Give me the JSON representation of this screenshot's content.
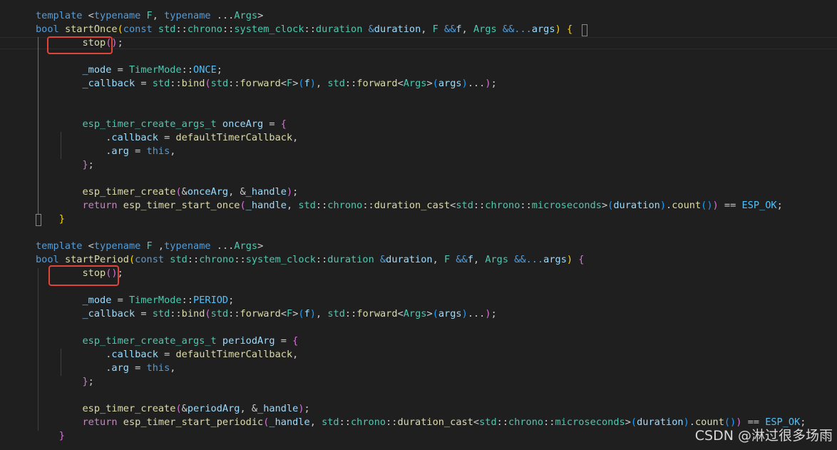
{
  "editor": {
    "lines": [
      [
        [
          "template",
          "kw"
        ],
        [
          " <",
          "pn"
        ],
        [
          "typename",
          "kw"
        ],
        [
          " ",
          "pn"
        ],
        [
          "F",
          "ty"
        ],
        [
          ", ",
          "pn"
        ],
        [
          "typename",
          "kw"
        ],
        [
          " ...",
          "pn"
        ],
        [
          "Args",
          "ty"
        ],
        [
          ">",
          "pn"
        ]
      ],
      [
        [
          "bool",
          "kw"
        ],
        [
          " ",
          "pn"
        ],
        [
          "startOnce",
          "fn"
        ],
        [
          "(",
          "b1"
        ],
        [
          "const",
          "kw"
        ],
        [
          " ",
          "pn"
        ],
        [
          "std",
          "ty"
        ],
        [
          "::",
          "pn"
        ],
        [
          "chrono",
          "ty"
        ],
        [
          "::",
          "pn"
        ],
        [
          "system_clock",
          "ty"
        ],
        [
          "::",
          "pn"
        ],
        [
          "duration",
          "ty"
        ],
        [
          " &",
          "kw"
        ],
        [
          "duration",
          "var"
        ],
        [
          ", ",
          "pn"
        ],
        [
          "F",
          "ty"
        ],
        [
          " &&",
          "kw"
        ],
        [
          "f",
          "var"
        ],
        [
          ", ",
          "pn"
        ],
        [
          "Args",
          "ty"
        ],
        [
          " &&...",
          "kw"
        ],
        [
          "args",
          "var"
        ],
        [
          ")",
          "b1"
        ],
        [
          " ",
          "pn"
        ],
        [
          "{",
          "b1"
        ]
      ],
      [
        [
          "        ",
          "pn"
        ],
        [
          "stop",
          "fn"
        ],
        [
          "()",
          "b2"
        ],
        [
          ";",
          "pn"
        ]
      ],
      [
        [
          "",
          "pn"
        ]
      ],
      [
        [
          "        ",
          "pn"
        ],
        [
          "_mode",
          "var"
        ],
        [
          " = ",
          "pn"
        ],
        [
          "TimerMode",
          "ty"
        ],
        [
          "::",
          "pn"
        ],
        [
          "ONCE",
          "en"
        ],
        [
          ";",
          "pn"
        ]
      ],
      [
        [
          "        ",
          "pn"
        ],
        [
          "_callback",
          "var"
        ],
        [
          " = ",
          "pn"
        ],
        [
          "std",
          "ty"
        ],
        [
          "::",
          "pn"
        ],
        [
          "bind",
          "fn"
        ],
        [
          "(",
          "b2"
        ],
        [
          "std",
          "ty"
        ],
        [
          "::",
          "pn"
        ],
        [
          "forward",
          "fn"
        ],
        [
          "<",
          "pn"
        ],
        [
          "F",
          "ty"
        ],
        [
          ">",
          "pn"
        ],
        [
          "(",
          "b3"
        ],
        [
          "f",
          "var"
        ],
        [
          ")",
          "b3"
        ],
        [
          ", ",
          "pn"
        ],
        [
          "std",
          "ty"
        ],
        [
          "::",
          "pn"
        ],
        [
          "forward",
          "fn"
        ],
        [
          "<",
          "pn"
        ],
        [
          "Args",
          "ty"
        ],
        [
          ">",
          "pn"
        ],
        [
          "(",
          "b3"
        ],
        [
          "args",
          "var"
        ],
        [
          ")",
          "b3"
        ],
        [
          "...",
          "pn"
        ],
        [
          ")",
          "b2"
        ],
        [
          ";",
          "pn"
        ]
      ],
      [
        [
          "",
          "pn"
        ]
      ],
      [
        [
          "",
          "pn"
        ]
      ],
      [
        [
          "        ",
          "pn"
        ],
        [
          "esp_timer_create_args_t",
          "ty"
        ],
        [
          " ",
          "pn"
        ],
        [
          "onceArg",
          "var"
        ],
        [
          " = ",
          "pn"
        ],
        [
          "{",
          "b2"
        ]
      ],
      [
        [
          "            ",
          "pn"
        ],
        [
          ".",
          "pn"
        ],
        [
          "callback",
          "var"
        ],
        [
          " = ",
          "pn"
        ],
        [
          "defaultTimerCallback",
          "fn"
        ],
        [
          ",",
          "pn"
        ]
      ],
      [
        [
          "            ",
          "pn"
        ],
        [
          ".",
          "pn"
        ],
        [
          "arg",
          "var"
        ],
        [
          " = ",
          "pn"
        ],
        [
          "this",
          "kw"
        ],
        [
          ",",
          "pn"
        ]
      ],
      [
        [
          "        ",
          "pn"
        ],
        [
          "}",
          "b2"
        ],
        [
          ";",
          "pn"
        ]
      ],
      [
        [
          "",
          "pn"
        ]
      ],
      [
        [
          "        ",
          "pn"
        ],
        [
          "esp_timer_create",
          "fn"
        ],
        [
          "(",
          "b2"
        ],
        [
          "&",
          "pn"
        ],
        [
          "onceArg",
          "var"
        ],
        [
          ", ",
          "pn"
        ],
        [
          "&",
          "pn"
        ],
        [
          "_handle",
          "var"
        ],
        [
          ")",
          "b2"
        ],
        [
          ";",
          "pn"
        ]
      ],
      [
        [
          "        ",
          "pn"
        ],
        [
          "return",
          "ctl"
        ],
        [
          " ",
          "pn"
        ],
        [
          "esp_timer_start_once",
          "fn"
        ],
        [
          "(",
          "b2"
        ],
        [
          "_handle",
          "var"
        ],
        [
          ", ",
          "pn"
        ],
        [
          "std",
          "ty"
        ],
        [
          "::",
          "pn"
        ],
        [
          "chrono",
          "ty"
        ],
        [
          "::",
          "pn"
        ],
        [
          "duration_cast",
          "fn"
        ],
        [
          "<",
          "pn"
        ],
        [
          "std",
          "ty"
        ],
        [
          "::",
          "pn"
        ],
        [
          "chrono",
          "ty"
        ],
        [
          "::",
          "pn"
        ],
        [
          "microseconds",
          "ty"
        ],
        [
          ">",
          "pn"
        ],
        [
          "(",
          "b3"
        ],
        [
          "duration",
          "var"
        ],
        [
          ")",
          "b3"
        ],
        [
          ".",
          "pn"
        ],
        [
          "count",
          "fn"
        ],
        [
          "()",
          "b3"
        ],
        [
          ")",
          "b2"
        ],
        [
          " == ",
          "pn"
        ],
        [
          "ESP_OK",
          "en"
        ],
        [
          ";",
          "pn"
        ]
      ],
      [
        [
          "    ",
          "pn"
        ],
        [
          "}",
          "b1"
        ]
      ],
      [
        [
          "",
          "pn"
        ]
      ],
      [
        [
          "template",
          "kw"
        ],
        [
          " <",
          "pn"
        ],
        [
          "typename",
          "kw"
        ],
        [
          " ",
          "pn"
        ],
        [
          "F",
          "ty"
        ],
        [
          " ,",
          "pn"
        ],
        [
          "typename",
          "kw"
        ],
        [
          " ...",
          "pn"
        ],
        [
          "Args",
          "ty"
        ],
        [
          ">",
          "pn"
        ]
      ],
      [
        [
          "bool",
          "kw"
        ],
        [
          " ",
          "pn"
        ],
        [
          "startPeriod",
          "fn"
        ],
        [
          "(",
          "b1"
        ],
        [
          "const",
          "kw"
        ],
        [
          " ",
          "pn"
        ],
        [
          "std",
          "ty"
        ],
        [
          "::",
          "pn"
        ],
        [
          "chrono",
          "ty"
        ],
        [
          "::",
          "pn"
        ],
        [
          "system_clock",
          "ty"
        ],
        [
          "::",
          "pn"
        ],
        [
          "duration",
          "ty"
        ],
        [
          " &",
          "kw"
        ],
        [
          "duration",
          "var"
        ],
        [
          ", ",
          "pn"
        ],
        [
          "F",
          "ty"
        ],
        [
          " &&",
          "kw"
        ],
        [
          "f",
          "var"
        ],
        [
          ", ",
          "pn"
        ],
        [
          "Args",
          "ty"
        ],
        [
          " &&...",
          "kw"
        ],
        [
          "args",
          "var"
        ],
        [
          ")",
          "b1"
        ],
        [
          " ",
          "pn"
        ],
        [
          "{",
          "b2"
        ]
      ],
      [
        [
          "        ",
          "pn"
        ],
        [
          "stop",
          "fn"
        ],
        [
          "()",
          "b2"
        ],
        [
          ";",
          "pn"
        ]
      ],
      [
        [
          "",
          "pn"
        ]
      ],
      [
        [
          "        ",
          "pn"
        ],
        [
          "_mode",
          "var"
        ],
        [
          " = ",
          "pn"
        ],
        [
          "TimerMode",
          "ty"
        ],
        [
          "::",
          "pn"
        ],
        [
          "PERIOD",
          "en"
        ],
        [
          ";",
          "pn"
        ]
      ],
      [
        [
          "        ",
          "pn"
        ],
        [
          "_callback",
          "var"
        ],
        [
          " = ",
          "pn"
        ],
        [
          "std",
          "ty"
        ],
        [
          "::",
          "pn"
        ],
        [
          "bind",
          "fn"
        ],
        [
          "(",
          "b2"
        ],
        [
          "std",
          "ty"
        ],
        [
          "::",
          "pn"
        ],
        [
          "forward",
          "fn"
        ],
        [
          "<",
          "pn"
        ],
        [
          "F",
          "ty"
        ],
        [
          ">",
          "pn"
        ],
        [
          "(",
          "b3"
        ],
        [
          "f",
          "var"
        ],
        [
          ")",
          "b3"
        ],
        [
          ", ",
          "pn"
        ],
        [
          "std",
          "ty"
        ],
        [
          "::",
          "pn"
        ],
        [
          "forward",
          "fn"
        ],
        [
          "<",
          "pn"
        ],
        [
          "Args",
          "ty"
        ],
        [
          ">",
          "pn"
        ],
        [
          "(",
          "b3"
        ],
        [
          "args",
          "var"
        ],
        [
          ")",
          "b3"
        ],
        [
          "...",
          "pn"
        ],
        [
          ")",
          "b2"
        ],
        [
          ";",
          "pn"
        ]
      ],
      [
        [
          "",
          "pn"
        ]
      ],
      [
        [
          "        ",
          "pn"
        ],
        [
          "esp_timer_create_args_t",
          "ty"
        ],
        [
          " ",
          "pn"
        ],
        [
          "periodArg",
          "var"
        ],
        [
          " = ",
          "pn"
        ],
        [
          "{",
          "b2"
        ]
      ],
      [
        [
          "            ",
          "pn"
        ],
        [
          ".",
          "pn"
        ],
        [
          "callback",
          "var"
        ],
        [
          " = ",
          "pn"
        ],
        [
          "defaultTimerCallback",
          "fn"
        ],
        [
          ",",
          "pn"
        ]
      ],
      [
        [
          "            ",
          "pn"
        ],
        [
          ".",
          "pn"
        ],
        [
          "arg",
          "var"
        ],
        [
          " = ",
          "pn"
        ],
        [
          "this",
          "kw"
        ],
        [
          ",",
          "pn"
        ]
      ],
      [
        [
          "        ",
          "pn"
        ],
        [
          "}",
          "b2"
        ],
        [
          ";",
          "pn"
        ]
      ],
      [
        [
          "",
          "pn"
        ]
      ],
      [
        [
          "        ",
          "pn"
        ],
        [
          "esp_timer_create",
          "fn"
        ],
        [
          "(",
          "b2"
        ],
        [
          "&",
          "pn"
        ],
        [
          "periodArg",
          "var"
        ],
        [
          ", ",
          "pn"
        ],
        [
          "&",
          "pn"
        ],
        [
          "_handle",
          "var"
        ],
        [
          ")",
          "b2"
        ],
        [
          ";",
          "pn"
        ]
      ],
      [
        [
          "        ",
          "pn"
        ],
        [
          "return",
          "ctl"
        ],
        [
          " ",
          "pn"
        ],
        [
          "esp_timer_start_periodic",
          "fn"
        ],
        [
          "(",
          "b2"
        ],
        [
          "_handle",
          "var"
        ],
        [
          ", ",
          "pn"
        ],
        [
          "std",
          "ty"
        ],
        [
          "::",
          "pn"
        ],
        [
          "chrono",
          "ty"
        ],
        [
          "::",
          "pn"
        ],
        [
          "duration_cast",
          "fn"
        ],
        [
          "<",
          "pn"
        ],
        [
          "std",
          "ty"
        ],
        [
          "::",
          "pn"
        ],
        [
          "chrono",
          "ty"
        ],
        [
          "::",
          "pn"
        ],
        [
          "microseconds",
          "ty"
        ],
        [
          ">",
          "pn"
        ],
        [
          "(",
          "b3"
        ],
        [
          "duration",
          "var"
        ],
        [
          ")",
          "b3"
        ],
        [
          ".",
          "pn"
        ],
        [
          "count",
          "fn"
        ],
        [
          "()",
          "b3"
        ],
        [
          ")",
          "b2"
        ],
        [
          " == ",
          "pn"
        ],
        [
          "ESP_OK",
          "en"
        ],
        [
          ";",
          "pn"
        ]
      ],
      [
        [
          "    ",
          "pn"
        ],
        [
          "}",
          "b2"
        ]
      ]
    ]
  },
  "watermark": "CSDN @淋过很多场雨",
  "colors": {
    "background": "#1f1f1f",
    "keyword": "#569cd6",
    "control": "#c586c0",
    "type": "#4ec9b0",
    "function": "#dcdcaa",
    "variable": "#9cdcfe",
    "enum_member": "#4fc1ff",
    "bracket_1": "#ffd700",
    "bracket_2": "#da70d6",
    "bracket_3": "#179fff",
    "annotation": "#e0453a"
  }
}
